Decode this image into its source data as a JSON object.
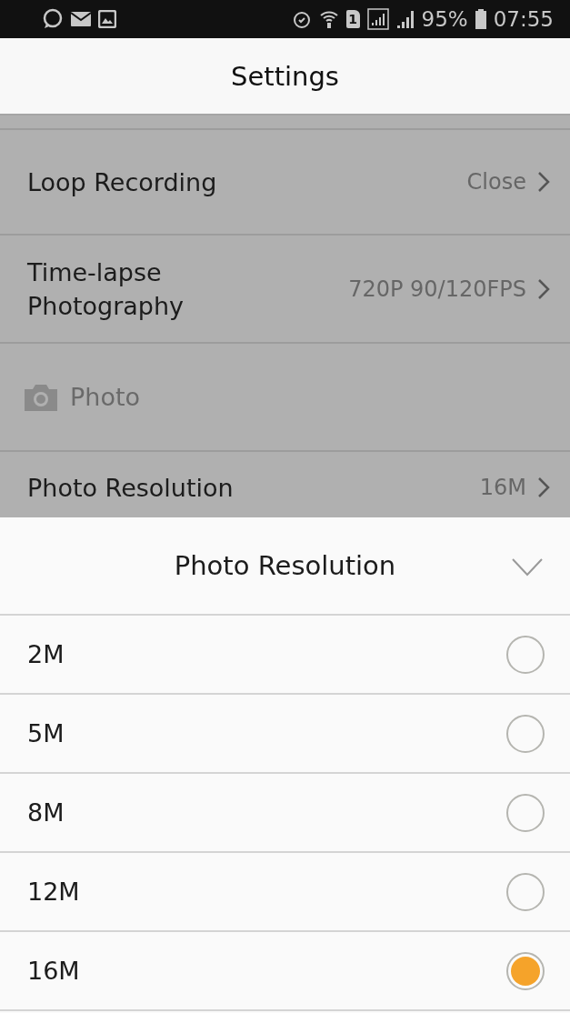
{
  "status_bar": {
    "sim_slot": "1",
    "battery": "95%",
    "time": "07:55"
  },
  "header": {
    "title": "Settings"
  },
  "settings": [
    {
      "kind": "row",
      "label": "Loop Recording",
      "value": "Close"
    },
    {
      "kind": "row",
      "label": "Time-lapse\nPhotography",
      "value": "720P 90/120FPS"
    },
    {
      "kind": "section",
      "label": "Photo"
    },
    {
      "kind": "row",
      "label": "Photo Resolution",
      "value": "16M"
    }
  ],
  "sheet": {
    "title": "Photo Resolution",
    "options": [
      {
        "label": "2M",
        "selected": false
      },
      {
        "label": "5M",
        "selected": false
      },
      {
        "label": "8M",
        "selected": false
      },
      {
        "label": "12M",
        "selected": false
      },
      {
        "label": "16M",
        "selected": true
      }
    ]
  }
}
